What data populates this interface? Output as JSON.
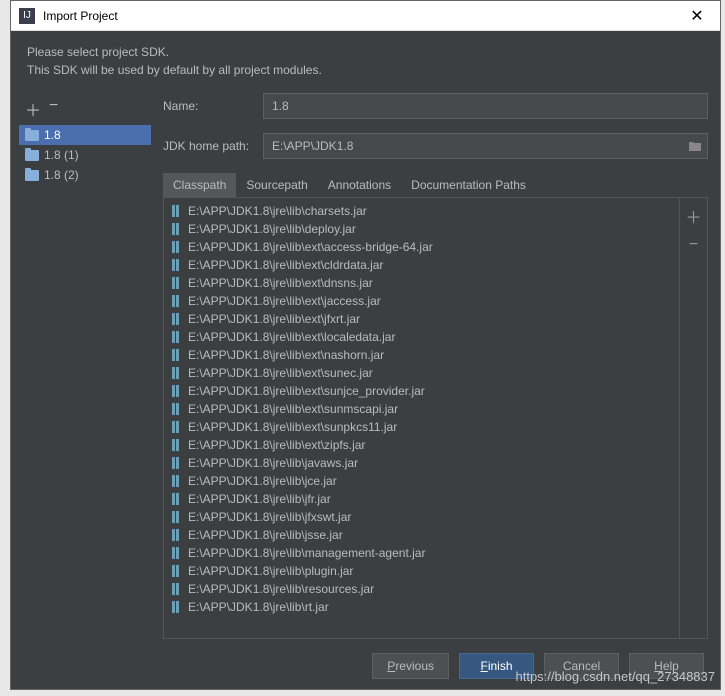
{
  "window": {
    "title": "Import Project"
  },
  "header": {
    "line1": "Please select project SDK.",
    "line2": "This SDK will be used by default by all project modules."
  },
  "sidebar": {
    "add": "＋",
    "remove": "−",
    "items": [
      {
        "label": "1.8",
        "selected": true
      },
      {
        "label": "1.8 (1)",
        "selected": false
      },
      {
        "label": "1.8 (2)",
        "selected": false
      }
    ]
  },
  "fields": {
    "name_label": "Name:",
    "name_value": "1.8",
    "path_label": "JDK home path:",
    "path_value": "E:\\APP\\JDK1.8"
  },
  "tabs": [
    {
      "label": "Classpath",
      "active": true
    },
    {
      "label": "Sourcepath",
      "active": false
    },
    {
      "label": "Annotations",
      "active": false
    },
    {
      "label": "Documentation Paths",
      "active": false
    }
  ],
  "classpath": [
    "E:\\APP\\JDK1.8\\jre\\lib\\charsets.jar",
    "E:\\APP\\JDK1.8\\jre\\lib\\deploy.jar",
    "E:\\APP\\JDK1.8\\jre\\lib\\ext\\access-bridge-64.jar",
    "E:\\APP\\JDK1.8\\jre\\lib\\ext\\cldrdata.jar",
    "E:\\APP\\JDK1.8\\jre\\lib\\ext\\dnsns.jar",
    "E:\\APP\\JDK1.8\\jre\\lib\\ext\\jaccess.jar",
    "E:\\APP\\JDK1.8\\jre\\lib\\ext\\jfxrt.jar",
    "E:\\APP\\JDK1.8\\jre\\lib\\ext\\localedata.jar",
    "E:\\APP\\JDK1.8\\jre\\lib\\ext\\nashorn.jar",
    "E:\\APP\\JDK1.8\\jre\\lib\\ext\\sunec.jar",
    "E:\\APP\\JDK1.8\\jre\\lib\\ext\\sunjce_provider.jar",
    "E:\\APP\\JDK1.8\\jre\\lib\\ext\\sunmscapi.jar",
    "E:\\APP\\JDK1.8\\jre\\lib\\ext\\sunpkcs11.jar",
    "E:\\APP\\JDK1.8\\jre\\lib\\ext\\zipfs.jar",
    "E:\\APP\\JDK1.8\\jre\\lib\\javaws.jar",
    "E:\\APP\\JDK1.8\\jre\\lib\\jce.jar",
    "E:\\APP\\JDK1.8\\jre\\lib\\jfr.jar",
    "E:\\APP\\JDK1.8\\jre\\lib\\jfxswt.jar",
    "E:\\APP\\JDK1.8\\jre\\lib\\jsse.jar",
    "E:\\APP\\JDK1.8\\jre\\lib\\management-agent.jar",
    "E:\\APP\\JDK1.8\\jre\\lib\\plugin.jar",
    "E:\\APP\\JDK1.8\\jre\\lib\\resources.jar",
    "E:\\APP\\JDK1.8\\jre\\lib\\rt.jar"
  ],
  "list_toolbar": {
    "add": "＋",
    "remove": "−"
  },
  "buttons": {
    "previous": "Previous",
    "finish": "Finish",
    "cancel": "Cancel",
    "help": "Help"
  },
  "watermark": "https://blog.csdn.net/qq_27348837"
}
